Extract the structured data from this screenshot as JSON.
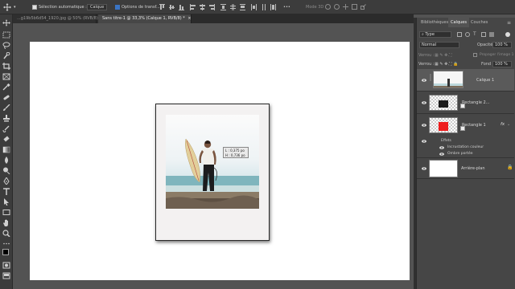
{
  "options_bar": {
    "auto_select_label": "Sélection automatique :",
    "auto_select_value": "Calque",
    "transform_label": "Options de transf...",
    "mode_3d_label": "Mode 3D :"
  },
  "tabs": [
    {
      "label": "...g19b5b6d54_1920.jpg @ 50% (RVB/8)",
      "close": "×"
    },
    {
      "label": "Sans titre-1 @ 33,3% (Calque 1, RVB/8) *",
      "close": "×"
    }
  ],
  "transform_tooltip": {
    "width_line": "L : 0,375 po",
    "height_line": "H : 0,736 po"
  },
  "panel": {
    "tabs": [
      "Bibliothèques",
      "Calques",
      "Couches"
    ],
    "active_tab": "Calques",
    "filter_label": "Type",
    "blend_mode": "Normal",
    "opacity_label": "Opacité :",
    "opacity_value": "100 %",
    "lock_label": "Verrou :",
    "propagate_label": "Propager l'image 1",
    "lock2_label": "Verrou :",
    "fill_label": "Fond :",
    "fill_value": "100 %",
    "layers": [
      {
        "name": "Calque 1",
        "selected": true
      },
      {
        "name": "Rectangle 2...",
        "selected": false
      },
      {
        "name": "Rectangle 1",
        "selected": false,
        "fx": "fx"
      },
      {
        "name": "Arrière-plan",
        "selected": false
      }
    ],
    "effects_label": "Effets",
    "effects": [
      "Incrustation couleur",
      "Ombre portée"
    ]
  },
  "colors": {
    "accent_blue": "#3a74c4",
    "red_swatch": "#ee1c1c",
    "dark_swatch": "#1a1a1a"
  }
}
